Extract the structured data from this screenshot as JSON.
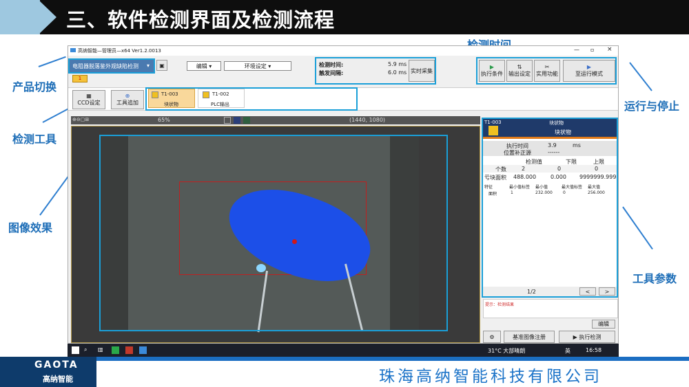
{
  "slide": {
    "title": "三、软件检测界面及检测流程",
    "company": "珠海高纳智能科技有限公司",
    "logo_text": "GAOTA",
    "logo_sub": "高纳智能"
  },
  "callouts": {
    "product_switch": "产品切换",
    "detect_tools": "检测工具",
    "image_effect": "图像效果",
    "detect_time": "检测时间",
    "run_stop": "运行与停止",
    "tool_params": "工具参数"
  },
  "app": {
    "window_title": "高纳智能—管理员—x64 Ver1.2.0013",
    "product_select": "电阻器脱落鉴外观缺陷检测",
    "tab_badge": "1",
    "menu_edit": "编辑",
    "menu_env": "环境设定",
    "timing": {
      "detect_label": "检测时间:",
      "detect_value": "5.9 ms",
      "trigger_label": "触发间隔:",
      "trigger_value": "6.0 ms",
      "realtime_btn": "实时采集"
    },
    "run_buttons": [
      "执行条件",
      "输出设定",
      "实用功能",
      "至运行模式"
    ],
    "ccd_btn": "CCD设定",
    "add_tool_btn": "工具追加",
    "tools": [
      {
        "id": "T1-003",
        "name": "块状物"
      },
      {
        "id": "T1-002",
        "name": "PLC输出"
      }
    ],
    "viewer": {
      "zoom": "65%",
      "coords": "(1440, 1080)"
    },
    "params": {
      "header_id": "T1-003",
      "header_name": "块状物",
      "tool_name": "块状物",
      "exec_time_label": "执行时间",
      "exec_time_value": "3.9",
      "exec_time_unit": "ms",
      "pos_label": "位置补正源",
      "pos_value": "------",
      "col_detect": "检测值",
      "col_lower": "下限",
      "col_upper": "上限",
      "rows": [
        {
          "label": "个数",
          "v": "2",
          "lo": "0",
          "hi": "0"
        },
        {
          "label": "亏块面积",
          "v": "488.000",
          "lo": "0.000",
          "hi": "9999999.999"
        }
      ],
      "feat_headers": [
        "特征",
        "最小值标签",
        "最小值",
        "最大值标签",
        "最大值"
      ],
      "feat_row": [
        "面积",
        "1",
        "232.000",
        "0",
        "256.000"
      ],
      "page": "1/2",
      "prev": "<",
      "next": ">",
      "note": "提示：检测结果",
      "edit_btn": "编辑",
      "ref_btn": "基准图像注册",
      "exec_btn": "执行检测"
    },
    "taskbar": {
      "weather": "31°C 大部晴朗",
      "ime": "英",
      "time": "16:58"
    }
  }
}
